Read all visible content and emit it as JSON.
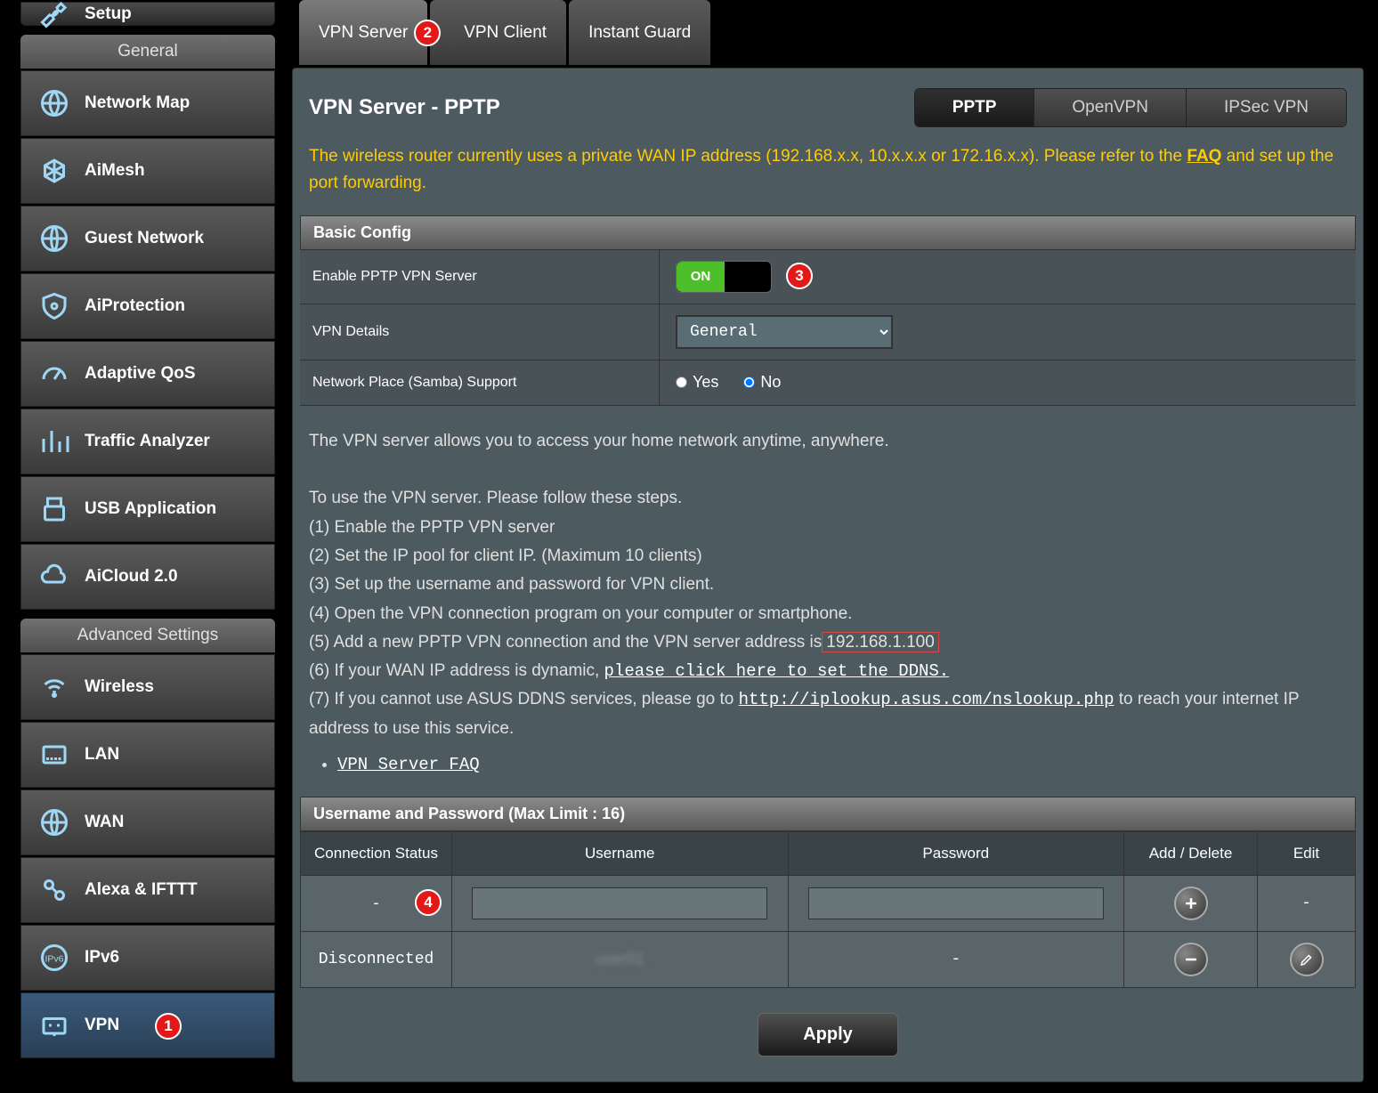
{
  "sidebar": {
    "setup_label": "Setup",
    "general_header": "General",
    "advanced_header": "Advanced Settings",
    "general_items": [
      {
        "id": "network-map",
        "label": "Network Map"
      },
      {
        "id": "aimesh",
        "label": "AiMesh"
      },
      {
        "id": "guest-network",
        "label": "Guest Network"
      },
      {
        "id": "aiprotection",
        "label": "AiProtection"
      },
      {
        "id": "adaptive-qos",
        "label": "Adaptive QoS"
      },
      {
        "id": "traffic-analyzer",
        "label": "Traffic Analyzer"
      },
      {
        "id": "usb-application",
        "label": "USB Application"
      },
      {
        "id": "aicloud",
        "label": "AiCloud 2.0"
      }
    ],
    "advanced_items": [
      {
        "id": "wireless",
        "label": "Wireless"
      },
      {
        "id": "lan",
        "label": "LAN"
      },
      {
        "id": "wan",
        "label": "WAN"
      },
      {
        "id": "alexa-ifttt",
        "label": "Alexa & IFTTT"
      },
      {
        "id": "ipv6",
        "label": "IPv6"
      },
      {
        "id": "vpn",
        "label": "VPN"
      }
    ]
  },
  "tabs": [
    {
      "id": "vpn-server",
      "label": "VPN Server"
    },
    {
      "id": "vpn-client",
      "label": "VPN Client"
    },
    {
      "id": "instant-guard",
      "label": "Instant Guard"
    }
  ],
  "page": {
    "title": "VPN Server - PPTP",
    "modes": [
      "PPTP",
      "OpenVPN",
      "IPSec VPN"
    ],
    "warning_pre": "The wireless router currently uses a private WAN IP address (192.168.x.x, 10.x.x.x or 172.16.x.x). Please refer to the ",
    "warning_faq": "FAQ",
    "warning_post": " and set up the port forwarding."
  },
  "config": {
    "section_title": "Basic Config",
    "enable_label": "Enable PPTP VPN Server",
    "toggle_text": "ON",
    "details_label": "VPN Details",
    "details_value": "General",
    "samba_label": "Network Place (Samba) Support",
    "samba_yes": "Yes",
    "samba_no": "No"
  },
  "desc": {
    "intro": "The VPN server allows you to access your home network anytime, anywhere.",
    "steps_intro": "To use the VPN server. Please follow these steps.",
    "step1": "(1) Enable the PPTP VPN server",
    "step2": "(2) Set the IP pool for client IP. (Maximum 10 clients)",
    "step3": "(3) Set up the username and password for VPN client.",
    "step4": "(4) Open the VPN connection program on your computer or smartphone.",
    "step5_pre": "(5) Add a new PPTP VPN connection and the VPN server address is",
    "step5_ip": "192.168.1.100",
    "step6_pre": "(6) If your WAN IP address is dynamic, ",
    "step6_link": "please click here to set the DDNS.",
    "step7_pre": "(7) If you cannot use ASUS DDNS services, please go to ",
    "step7_link": "http://iplookup.asus.com/nslookup.php",
    "step7_post": " to reach your internet IP address to use this service.",
    "faq_link": "VPN Server FAQ"
  },
  "user_table": {
    "title": "Username and Password (Max Limit : 16)",
    "headers": [
      "Connection Status",
      "Username",
      "Password",
      "Add / Delete",
      "Edit"
    ],
    "rows": [
      {
        "status": "-",
        "username": "",
        "password": "",
        "action": "add",
        "edit": "-"
      },
      {
        "status": "Disconnected",
        "username": "hidden",
        "password": "-",
        "action": "remove",
        "edit": "edit"
      }
    ]
  },
  "apply_label": "Apply",
  "badges": {
    "b1": "1",
    "b2": "2",
    "b3": "3",
    "b4": "4"
  }
}
